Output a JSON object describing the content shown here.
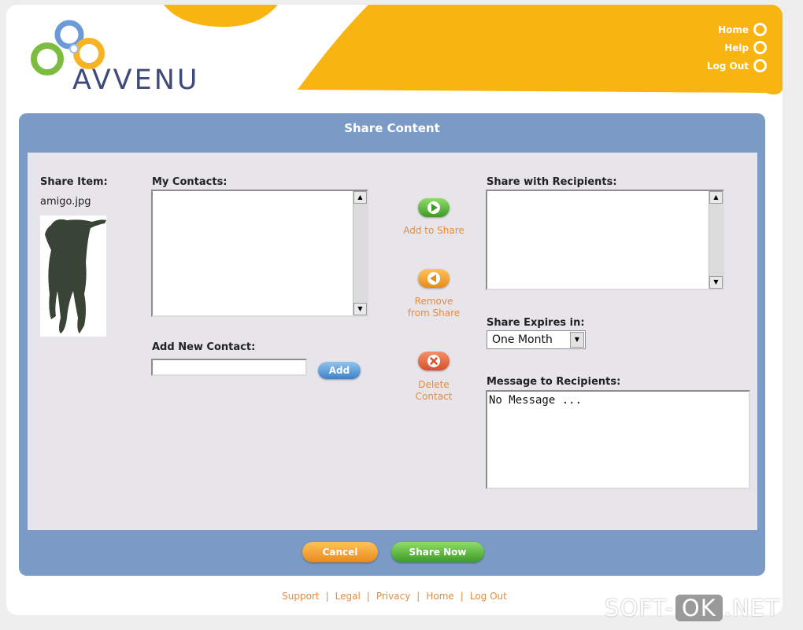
{
  "brand": {
    "name": "AVVENU"
  },
  "nav": {
    "items": [
      "Home",
      "Help",
      "Log Out"
    ]
  },
  "panel": {
    "title": "Share Content"
  },
  "share_item": {
    "label": "Share Item:",
    "filename": "amigo.jpg"
  },
  "my_contacts": {
    "label": "My Contacts:"
  },
  "add_contact": {
    "label": "Add New Contact:",
    "value": "",
    "button": "Add"
  },
  "actions": {
    "add": "Add to Share",
    "remove": "Remove from Share",
    "delete": "Delete Contact"
  },
  "recipients": {
    "label": "Share with Recipients:"
  },
  "expires": {
    "label": "Share Expires in:",
    "selected": "One Month"
  },
  "message": {
    "label": "Message to Recipients:",
    "value": "No Message ..."
  },
  "buttons": {
    "cancel": "Cancel",
    "share": "Share Now"
  },
  "footer": {
    "links": [
      "Support",
      "Legal",
      "Privacy",
      "Home",
      "Log Out"
    ]
  },
  "watermark": {
    "pre": "SOFT-",
    "ok": "OK",
    "post": ".NET"
  },
  "colors": {
    "header_yellow": "#f8b511",
    "panel_blue": "#7b9ac6",
    "orange_accent": "#e88a3c",
    "green_button": "#4aa82d"
  }
}
